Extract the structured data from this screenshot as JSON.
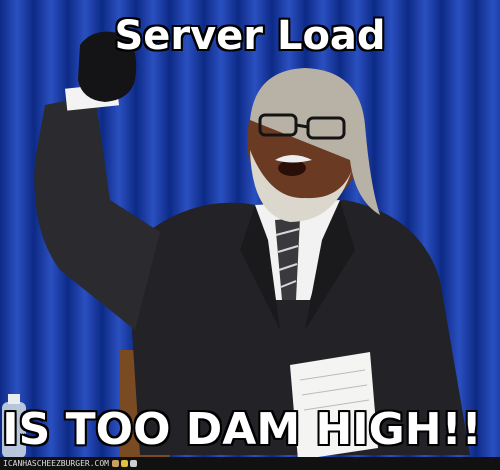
{
  "meme": {
    "top_text": "Server Load",
    "bottom_text": "IS TOO DAM HIGH!!",
    "watermark": "ICANHASCHEEZBURGER.COM"
  },
  "colors": {
    "curtain_blue": "#1f3fa8",
    "curtain_dark": "#0d2470",
    "suit": "#222124",
    "skin": "#6b3a22",
    "beard": "#d9d4c8",
    "caption_fill": "#ffffff",
    "caption_stroke": "#000000"
  },
  "icons": [
    "cat-logo-icon",
    "cheezburger-logo-icon",
    "paw-icon"
  ]
}
